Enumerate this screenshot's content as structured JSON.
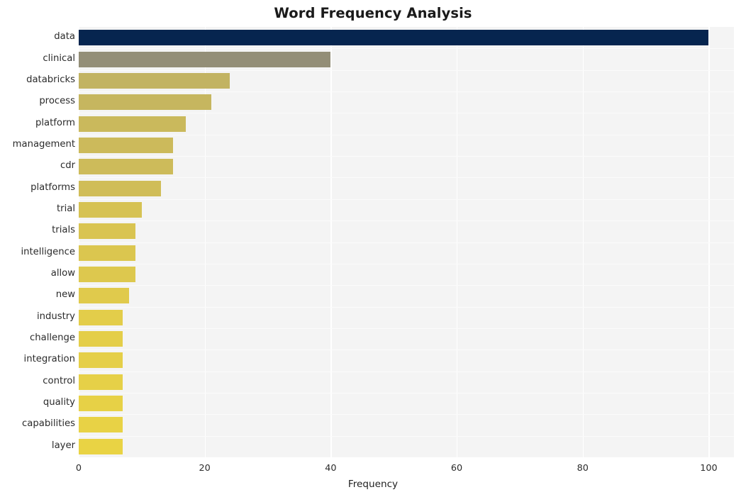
{
  "chart_data": {
    "type": "bar",
    "orientation": "horizontal",
    "title": "Word Frequency Analysis",
    "xlabel": "Frequency",
    "ylabel": "",
    "categories": [
      "data",
      "clinical",
      "databricks",
      "process",
      "platform",
      "management",
      "cdr",
      "platforms",
      "trial",
      "trials",
      "intelligence",
      "allow",
      "new",
      "industry",
      "challenge",
      "integration",
      "control",
      "quality",
      "capabilities",
      "layer"
    ],
    "values": [
      100,
      40,
      24,
      21,
      17,
      15,
      15,
      13,
      10,
      9,
      9,
      9,
      8,
      7,
      7,
      7,
      7,
      7,
      7,
      7
    ],
    "bar_colors": [
      "#06254f",
      "#938e77",
      "#c2b362",
      "#c6b65f",
      "#cab95c",
      "#ccba5b",
      "#cdbb5a",
      "#d0bd58",
      "#d6c253",
      "#d9c451",
      "#dbc64f",
      "#ddc84e",
      "#e0ca4c",
      "#e3cd4a",
      "#e4ce49",
      "#e5cf48",
      "#e6d047",
      "#e7d146",
      "#e8d245",
      "#e9d344"
    ],
    "xticks": [
      0,
      20,
      40,
      60,
      80,
      100
    ],
    "xlim": [
      0,
      104
    ],
    "grid": "vertical",
    "legend": "none",
    "plot_background": "#f4f4f4",
    "gridline_color": "#ffffff",
    "figure_background": "#ffffff"
  }
}
